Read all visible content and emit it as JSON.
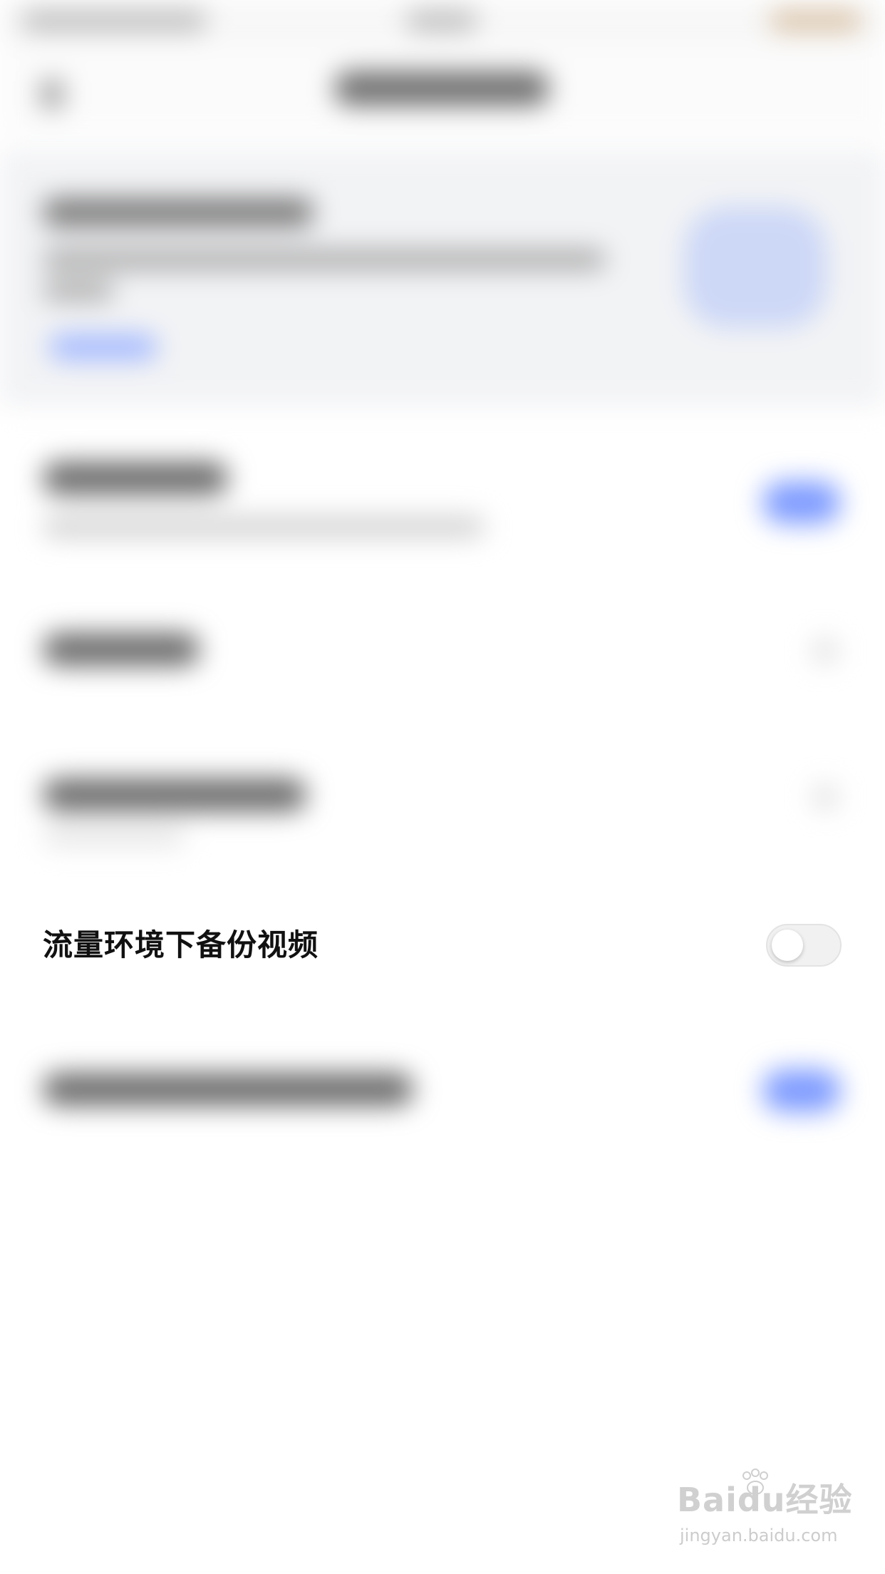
{
  "setting_row": {
    "label": "流量环境下备份视频",
    "toggle_state": "off"
  },
  "watermark": {
    "logo_text": "Baidu经验",
    "url_text": "jingyan.baidu.com"
  },
  "colors": {
    "accent_blue": "#7f9cff",
    "toggle_off_track": "#f1f1f1",
    "toggle_knob": "#ffffff",
    "label_text": "#111111"
  }
}
